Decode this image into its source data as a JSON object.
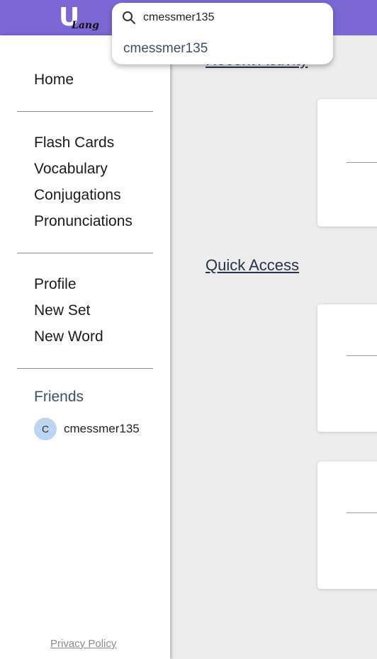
{
  "header": {
    "logo_main": "U",
    "logo_sub": "Lang"
  },
  "search": {
    "value": "cmessmer135",
    "icon": "search-icon",
    "results": [
      "cmessmer135"
    ]
  },
  "sidebar": {
    "home": "Home",
    "learn": [
      "Flash Cards",
      "Vocabulary",
      "Conjugations",
      "Pronunciations"
    ],
    "account": [
      "Profile",
      "New Set",
      "New Word"
    ],
    "friends_title": "Friends",
    "friends": [
      {
        "initial": "C",
        "name": "cmessmer135"
      }
    ],
    "privacy": "Privacy Policy"
  },
  "main": {
    "recent_title": "Recent Activity",
    "quick_title": "Quick Access"
  },
  "colors": {
    "topbar": "#7c68d5",
    "avatar": "#bcd6f2",
    "heading": "#263247"
  }
}
